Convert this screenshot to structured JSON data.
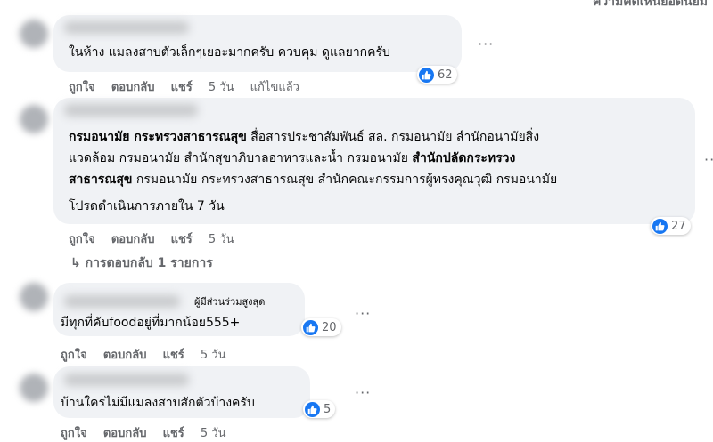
{
  "top_right_text": "ความคิดเห็นยอดนิยม",
  "comments": [
    {
      "text": "ในห้าง แมลงสาบตัวเล็กๆเยอะมากครับ ควบคุม ดูแลยากครับ",
      "actions": {
        "like": "ถูกใจ",
        "reply": "ตอบกลับ",
        "share": "แชร์",
        "time": "5 วัน",
        "edited": "แก้ไขแล้ว"
      },
      "reactions": "62"
    },
    {
      "tag1": "กรมอนามัย กระทรวงสาธารณสุข",
      "line1_rest": " สื่อสารประชาสัมพันธ์ สล. กรมอนามัย สำนักอนามัยสิ่ง",
      "line2_start": "แวดล้อม กรมอนามัย สำนักสุขาภิบาลอาหารและน้ำ กรมอนามัย ",
      "tag2_a": "สำนักปลัดกระทรวง",
      "tag2_b": "สาธารณสุข",
      "line3_rest": " กรมอนามัย กระทรวงสาธารณสุข สำนักคณะกรรมการผู้ทรงคุณวุฒิ กรมอนามัย",
      "line4": "โปรดดำเนินการภายใน 7 วัน",
      "actions": {
        "like": "ถูกใจ",
        "reply": "ตอบกลับ",
        "share": "แชร์",
        "time": "5 วัน"
      },
      "reactions": "27",
      "replies_link": "การตอบกลับ 1 รายการ"
    },
    {
      "badge": "ผู้มีส่วนร่วมสูงสุด",
      "text": "มีทุกที่คับfoodอยู่ที่มากน้อย555+",
      "actions": {
        "like": "ถูกใจ",
        "reply": "ตอบกลับ",
        "share": "แชร์",
        "time": "5 วัน"
      },
      "reactions": "20"
    },
    {
      "text": "บ้านใครไม่มีแมลงสาบสักตัวบ้างครับ",
      "actions": {
        "like": "ถูกใจ",
        "reply": "ตอบกลับ",
        "share": "แชร์",
        "time": "5 วัน"
      },
      "reactions": "5"
    }
  ],
  "more_icon": "···",
  "reply_arrow_icon": "↳",
  "colors": {
    "accent": "#1877f2",
    "bubble": "#f0f2f5",
    "meta": "#65676b"
  }
}
